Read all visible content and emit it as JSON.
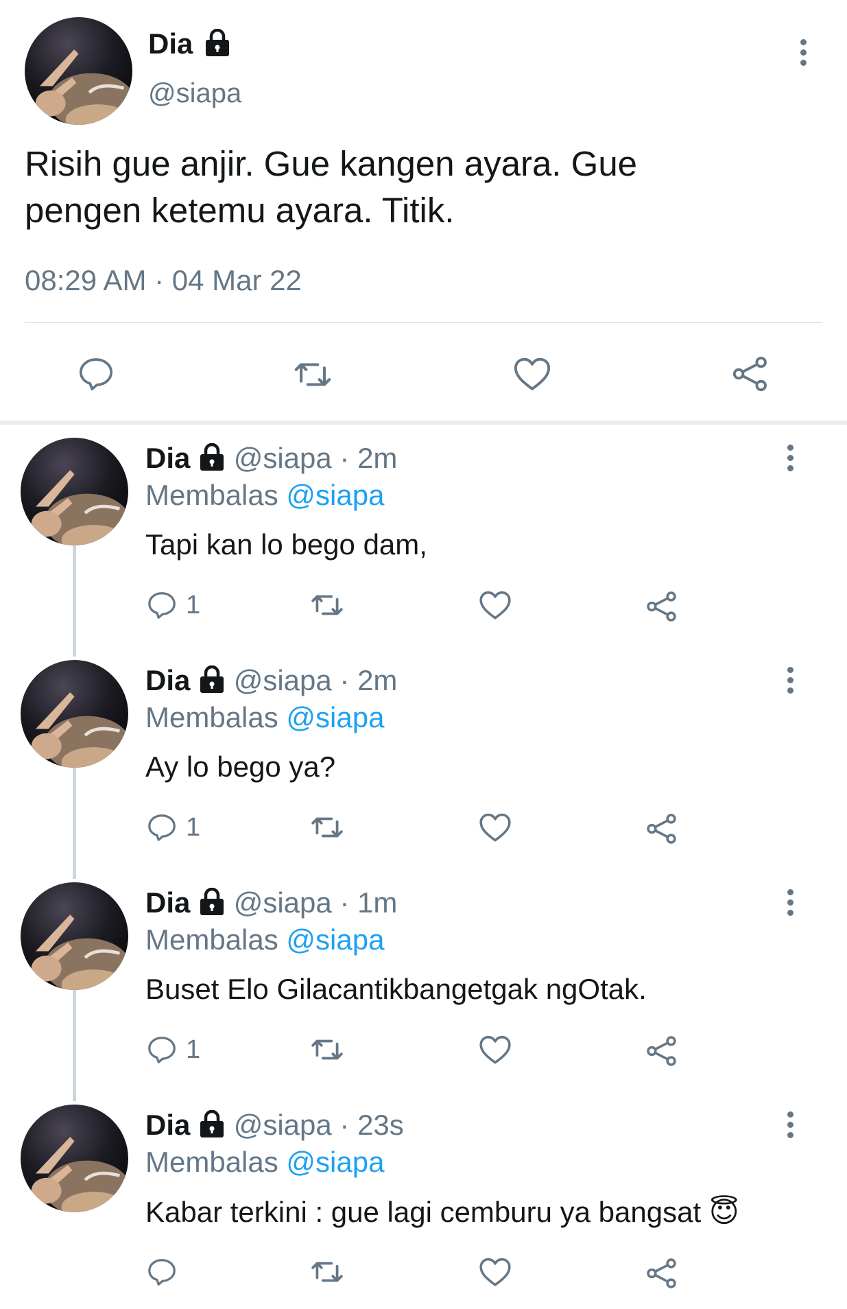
{
  "main_tweet": {
    "display_name": "Dia",
    "handle": "@siapa",
    "text_line1": "Risih gue anjir. Gue kangen ayara. Gue",
    "text_line2": "pengen ketemu ayara. Titik.",
    "timestamp": "08:29 AM · 04 Mar 22",
    "icons": [
      "reply-icon",
      "retweet-icon",
      "like-icon",
      "share-icon"
    ]
  },
  "replies": [
    {
      "display_name": "Dia",
      "handle": "@siapa",
      "time": "· 2m",
      "replying_prefix": "Membalas",
      "replying_to": "@siapa",
      "text": "Tapi kan lo bego dam,",
      "reply_count": "1"
    },
    {
      "display_name": "Dia",
      "handle": "@siapa",
      "time": "· 2m",
      "replying_prefix": "Membalas",
      "replying_to": "@siapa",
      "text": "Ay lo bego ya?",
      "reply_count": "1"
    },
    {
      "display_name": "Dia",
      "handle": "@siapa",
      "time": "· 1m",
      "replying_prefix": "Membalas",
      "replying_to": "@siapa",
      "text": "Buset Elo Gilacantikbangetgak ngOtak.",
      "reply_count": "1"
    },
    {
      "display_name": "Dia",
      "handle": "@siapa",
      "time": "· 23s",
      "replying_prefix": "Membalas",
      "replying_to": "@siapa",
      "text": "Kabar terkini : gue lagi cemburu ya bangsat",
      "emoji": "😇",
      "reply_count": ""
    }
  ],
  "colors": {
    "accent": "#1da1f2",
    "muted": "#657786",
    "text": "#14171a",
    "divider": "#e1e8ed"
  }
}
